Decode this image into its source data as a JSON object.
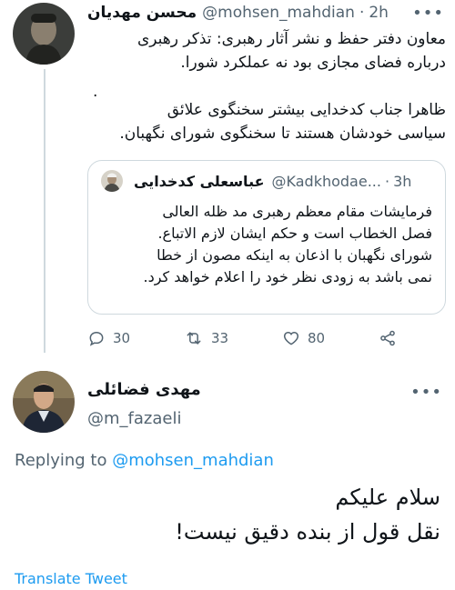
{
  "tweet1": {
    "name": "محسن مهدیان",
    "handle": "@mohsen_mahdian",
    "separator": "·",
    "time": "2h",
    "text_lines": [
      "معاون دفتر حفظ و نشر آثار رهبری: تذکر رهبری",
      "درباره فضای مجازی بود نه عملکرد شورا."
    ],
    "dot": ".",
    "text_lines2": [
      "ظاهرا جناب کدخدایی بیشتر سخنگوی علائق",
      "سیاسی خودشان هستند تا سخنگوی شورای نگهبان."
    ],
    "menu": "•••"
  },
  "quote": {
    "name": "عباسعلی کدخدایی",
    "handle": "@Kadkhodae...",
    "separator": "·",
    "time": "3h",
    "text_lines": [
      "فرمایشات مقام معظم رهبری مد ظله العالی",
      "فصل الخطاب است و حکم ایشان لازم الاتباع.",
      "شورای نگهبان با اذعان به اینکه مصون از خطا",
      "نمی باشد به زودی نظر خود را اعلام خواهد کرد."
    ]
  },
  "actions": {
    "replies": "30",
    "retweets": "33",
    "likes": "80"
  },
  "tweet2": {
    "name": "مهدی فضائلی",
    "handle": "@m_fazaeli",
    "replying_prefix": "Replying to",
    "replying_to": "@mohsen_mahdian",
    "text_lines": [
      "سلام علیکم",
      "نقل قول از بنده دقیق نیست!"
    ],
    "translate": "Translate Tweet",
    "menu": "•••"
  },
  "colors": {
    "accent": "#1d9bf0",
    "secondary_text": "#536471",
    "border": "#cfd9de"
  }
}
